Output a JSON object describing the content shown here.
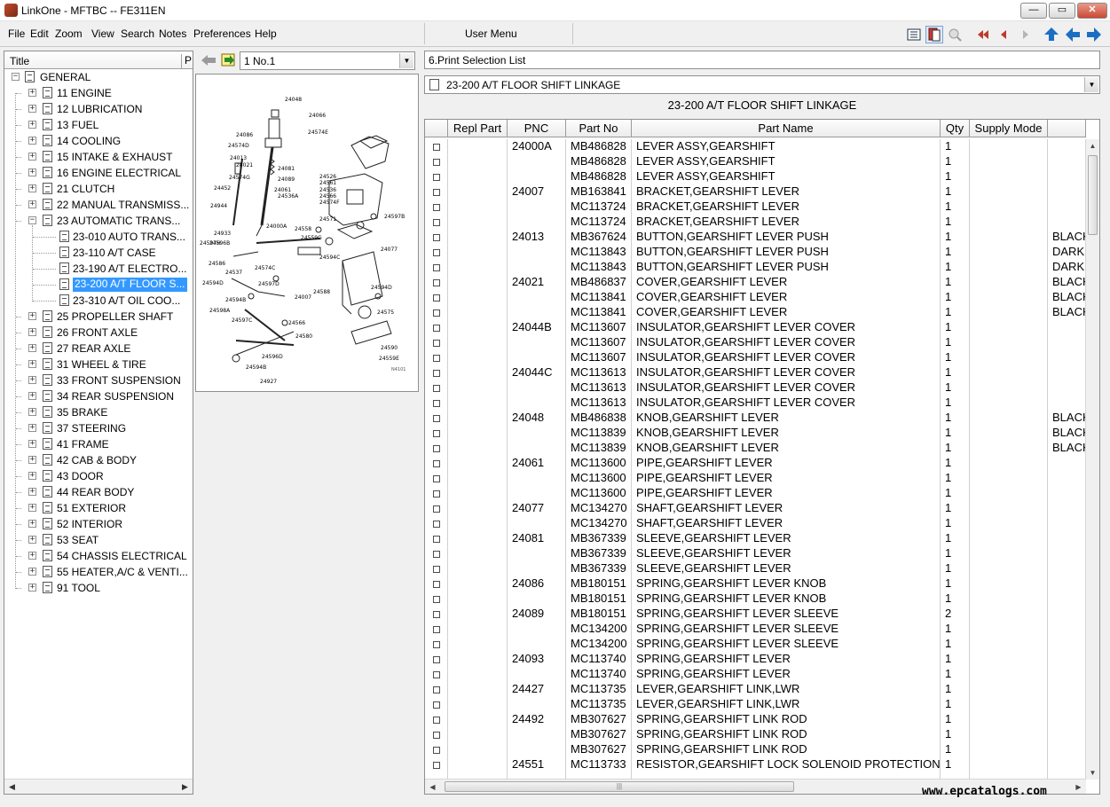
{
  "window": {
    "title": "LinkOne - MFTBC -- FE311EN",
    "controls": [
      "—",
      "▭",
      "✕"
    ]
  },
  "menu": [
    "File",
    "Edit",
    "Zoom",
    "View",
    "Search",
    "Notes",
    "Preferences",
    "Help"
  ],
  "user_menu": "User Menu",
  "toolbar_icons": [
    "list-view-icon",
    "book-view-icon",
    "search-disabled-icon",
    "first-icon",
    "previous-icon",
    "next-icon",
    "home-icon",
    "back-icon",
    "forward-icon"
  ],
  "tree": {
    "header": {
      "title": "Title",
      "p": "P"
    },
    "items": [
      {
        "label": "GENERAL",
        "level": 0,
        "expanded": true
      },
      {
        "label": "11 ENGINE",
        "level": 1
      },
      {
        "label": "12 LUBRICATION",
        "level": 1
      },
      {
        "label": "13 FUEL",
        "level": 1
      },
      {
        "label": "14 COOLING",
        "level": 1
      },
      {
        "label": "15 INTAKE & EXHAUST",
        "level": 1
      },
      {
        "label": "16 ENGINE ELECTRICAL",
        "level": 1
      },
      {
        "label": "21 CLUTCH",
        "level": 1
      },
      {
        "label": "22 MANUAL TRANSMISS...",
        "level": 1
      },
      {
        "label": "23 AUTOMATIC TRANS...",
        "level": 1,
        "expanded": true
      },
      {
        "label": "23-010 AUTO TRANS...",
        "level": 2
      },
      {
        "label": "23-110 A/T CASE",
        "level": 2
      },
      {
        "label": "23-190 A/T ELECTRO...",
        "level": 2
      },
      {
        "label": "23-200 A/T FLOOR S...",
        "level": 2,
        "selected": true
      },
      {
        "label": "23-310 A/T OIL COO...",
        "level": 2
      },
      {
        "label": "25 PROPELLER SHAFT",
        "level": 1
      },
      {
        "label": "26 FRONT AXLE",
        "level": 1
      },
      {
        "label": "27 REAR AXLE",
        "level": 1
      },
      {
        "label": "31 WHEEL & TIRE",
        "level": 1
      },
      {
        "label": "33 FRONT SUSPENSION",
        "level": 1
      },
      {
        "label": "34 REAR SUSPENSION",
        "level": 1
      },
      {
        "label": "35 BRAKE",
        "level": 1
      },
      {
        "label": "37 STEERING",
        "level": 1
      },
      {
        "label": "41 FRAME",
        "level": 1
      },
      {
        "label": "42 CAB & BODY",
        "level": 1
      },
      {
        "label": "43 DOOR",
        "level": 1
      },
      {
        "label": "44 REAR BODY",
        "level": 1
      },
      {
        "label": "51 EXTERIOR",
        "level": 1
      },
      {
        "label": "52 INTERIOR",
        "level": 1
      },
      {
        "label": "53 SEAT",
        "level": 1
      },
      {
        "label": "54 CHASSIS ELECTRICAL",
        "level": 1
      },
      {
        "label": "55 HEATER,A/C & VENTI...",
        "level": 1
      },
      {
        "label": "91 TOOL",
        "level": 1
      }
    ]
  },
  "diagram": {
    "nav_value": "1 No.1",
    "callouts": [
      "24048",
      "24066",
      "24086",
      "24013",
      "24574E",
      "24021",
      "24574D",
      "24081",
      "24574G",
      "24452",
      "24089",
      "24061",
      "24536A",
      "24944",
      "24000A",
      "24526",
      "24561",
      "24536",
      "24566",
      "24574F",
      "24571",
      "24077",
      "24597B",
      "24558",
      "24596B",
      "24933",
      "24559G",
      "24594C",
      "24597H",
      "24586",
      "24537",
      "24594D",
      "24597D",
      "24594B",
      "24598A",
      "24597C",
      "24007",
      "24594D",
      "24588",
      "24575",
      "24566",
      "24580",
      "24590",
      "24559E",
      "24596D",
      "24927",
      "24594B",
      "24574C"
    ]
  },
  "right": {
    "print_list": "6.Print Selection List",
    "group_combo": "23-200 A/T FLOOR SHIFT LINKAGE",
    "subtitle": "23-200 A/T FLOOR SHIFT LINKAGE",
    "columns": [
      "",
      "Repl Part",
      "PNC",
      "Part No",
      "Part Name",
      "Qty",
      "Supply Mode",
      ""
    ],
    "rows": [
      [
        "",
        "24000A",
        "MB486828",
        "LEVER ASSY,GEARSHIFT",
        "1",
        "",
        ""
      ],
      [
        "",
        "",
        "MB486828",
        "LEVER ASSY,GEARSHIFT",
        "1",
        "",
        ""
      ],
      [
        "",
        "",
        "MB486828",
        "LEVER ASSY,GEARSHIFT",
        "1",
        "",
        ""
      ],
      [
        "",
        "24007",
        "MB163841",
        "BRACKET,GEARSHIFT LEVER",
        "1",
        "",
        ""
      ],
      [
        "",
        "",
        "MC113724",
        "BRACKET,GEARSHIFT LEVER",
        "1",
        "",
        ""
      ],
      [
        "",
        "",
        "MC113724",
        "BRACKET,GEARSHIFT LEVER",
        "1",
        "",
        ""
      ],
      [
        "",
        "24013",
        "MB367624",
        "BUTTON,GEARSHIFT LEVER PUSH",
        "1",
        "",
        "BLACK"
      ],
      [
        "",
        "",
        "MC113843",
        "BUTTON,GEARSHIFT LEVER PUSH",
        "1",
        "",
        "DARK"
      ],
      [
        "",
        "",
        "MC113843",
        "BUTTON,GEARSHIFT LEVER PUSH",
        "1",
        "",
        "DARK"
      ],
      [
        "",
        "24021",
        "MB486837",
        "COVER,GEARSHIFT LEVER",
        "1",
        "",
        "BLACK"
      ],
      [
        "",
        "",
        "MC113841",
        "COVER,GEARSHIFT LEVER",
        "1",
        "",
        "BLACK"
      ],
      [
        "",
        "",
        "MC113841",
        "COVER,GEARSHIFT LEVER",
        "1",
        "",
        "BLACK"
      ],
      [
        "",
        "24044B",
        "MC113607",
        "INSULATOR,GEARSHIFT LEVER COVER",
        "1",
        "",
        ""
      ],
      [
        "",
        "",
        "MC113607",
        "INSULATOR,GEARSHIFT LEVER COVER",
        "1",
        "",
        ""
      ],
      [
        "",
        "",
        "MC113607",
        "INSULATOR,GEARSHIFT LEVER COVER",
        "1",
        "",
        ""
      ],
      [
        "",
        "24044C",
        "MC113613",
        "INSULATOR,GEARSHIFT LEVER COVER",
        "1",
        "",
        ""
      ],
      [
        "",
        "",
        "MC113613",
        "INSULATOR,GEARSHIFT LEVER COVER",
        "1",
        "",
        ""
      ],
      [
        "",
        "",
        "MC113613",
        "INSULATOR,GEARSHIFT LEVER COVER",
        "1",
        "",
        ""
      ],
      [
        "",
        "24048",
        "MB486838",
        "KNOB,GEARSHIFT LEVER",
        "1",
        "",
        "BLACK"
      ],
      [
        "",
        "",
        "MC113839",
        "KNOB,GEARSHIFT LEVER",
        "1",
        "",
        "BLACK"
      ],
      [
        "",
        "",
        "MC113839",
        "KNOB,GEARSHIFT LEVER",
        "1",
        "",
        "BLACK"
      ],
      [
        "",
        "24061",
        "MC113600",
        "PIPE,GEARSHIFT LEVER",
        "1",
        "",
        ""
      ],
      [
        "",
        "",
        "MC113600",
        "PIPE,GEARSHIFT LEVER",
        "1",
        "",
        ""
      ],
      [
        "",
        "",
        "MC113600",
        "PIPE,GEARSHIFT LEVER",
        "1",
        "",
        ""
      ],
      [
        "",
        "24077",
        "MC134270",
        "SHAFT,GEARSHIFT LEVER",
        "1",
        "",
        ""
      ],
      [
        "",
        "",
        "MC134270",
        "SHAFT,GEARSHIFT LEVER",
        "1",
        "",
        ""
      ],
      [
        "",
        "24081",
        "MB367339",
        "SLEEVE,GEARSHIFT LEVER",
        "1",
        "",
        ""
      ],
      [
        "",
        "",
        "MB367339",
        "SLEEVE,GEARSHIFT LEVER",
        "1",
        "",
        ""
      ],
      [
        "",
        "",
        "MB367339",
        "SLEEVE,GEARSHIFT LEVER",
        "1",
        "",
        ""
      ],
      [
        "",
        "24086",
        "MB180151",
        "SPRING,GEARSHIFT LEVER KNOB",
        "1",
        "",
        ""
      ],
      [
        "",
        "",
        "MB180151",
        "SPRING,GEARSHIFT LEVER KNOB",
        "1",
        "",
        ""
      ],
      [
        "",
        "24089",
        "MB180151",
        "SPRING,GEARSHIFT LEVER SLEEVE",
        "2",
        "",
        ""
      ],
      [
        "",
        "",
        "MC134200",
        "SPRING,GEARSHIFT LEVER SLEEVE",
        "1",
        "",
        ""
      ],
      [
        "",
        "",
        "MC134200",
        "SPRING,GEARSHIFT LEVER SLEEVE",
        "1",
        "",
        ""
      ],
      [
        "",
        "24093",
        "MC113740",
        "SPRING,GEARSHIFT LEVER",
        "1",
        "",
        ""
      ],
      [
        "",
        "",
        "MC113740",
        "SPRING,GEARSHIFT LEVER",
        "1",
        "",
        ""
      ],
      [
        "",
        "24427",
        "MC113735",
        "LEVER,GEARSHIFT LINK,LWR",
        "1",
        "",
        ""
      ],
      [
        "",
        "",
        "MC113735",
        "LEVER,GEARSHIFT LINK,LWR",
        "1",
        "",
        ""
      ],
      [
        "",
        "24492",
        "MB307627",
        "SPRING,GEARSHIFT LINK ROD",
        "1",
        "",
        ""
      ],
      [
        "",
        "",
        "MB307627",
        "SPRING,GEARSHIFT LINK ROD",
        "1",
        "",
        ""
      ],
      [
        "",
        "",
        "MB307627",
        "SPRING,GEARSHIFT LINK ROD",
        "1",
        "",
        ""
      ],
      [
        "",
        "24551",
        "MC113733",
        "RESISTOR,GEARSHIFT LOCK SOLENOID PROTECTION",
        "1",
        "",
        ""
      ]
    ]
  },
  "watermark": "www.epcatalogs.com"
}
